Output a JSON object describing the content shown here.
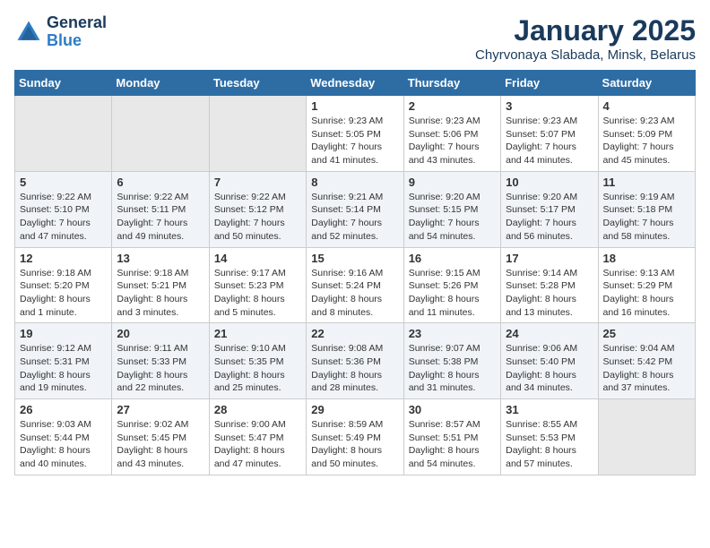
{
  "header": {
    "logo_line1": "General",
    "logo_line2": "Blue",
    "month_title": "January 2025",
    "location": "Chyrvonaya Slabada, Minsk, Belarus"
  },
  "weekdays": [
    "Sunday",
    "Monday",
    "Tuesday",
    "Wednesday",
    "Thursday",
    "Friday",
    "Saturday"
  ],
  "weeks": [
    [
      {
        "day": "",
        "empty": true
      },
      {
        "day": "",
        "empty": true
      },
      {
        "day": "",
        "empty": true
      },
      {
        "day": "1",
        "lines": [
          "Sunrise: 9:23 AM",
          "Sunset: 5:05 PM",
          "Daylight: 7 hours",
          "and 41 minutes."
        ]
      },
      {
        "day": "2",
        "lines": [
          "Sunrise: 9:23 AM",
          "Sunset: 5:06 PM",
          "Daylight: 7 hours",
          "and 43 minutes."
        ]
      },
      {
        "day": "3",
        "lines": [
          "Sunrise: 9:23 AM",
          "Sunset: 5:07 PM",
          "Daylight: 7 hours",
          "and 44 minutes."
        ]
      },
      {
        "day": "4",
        "lines": [
          "Sunrise: 9:23 AM",
          "Sunset: 5:09 PM",
          "Daylight: 7 hours",
          "and 45 minutes."
        ]
      }
    ],
    [
      {
        "day": "5",
        "lines": [
          "Sunrise: 9:22 AM",
          "Sunset: 5:10 PM",
          "Daylight: 7 hours",
          "and 47 minutes."
        ]
      },
      {
        "day": "6",
        "lines": [
          "Sunrise: 9:22 AM",
          "Sunset: 5:11 PM",
          "Daylight: 7 hours",
          "and 49 minutes."
        ]
      },
      {
        "day": "7",
        "lines": [
          "Sunrise: 9:22 AM",
          "Sunset: 5:12 PM",
          "Daylight: 7 hours",
          "and 50 minutes."
        ]
      },
      {
        "day": "8",
        "lines": [
          "Sunrise: 9:21 AM",
          "Sunset: 5:14 PM",
          "Daylight: 7 hours",
          "and 52 minutes."
        ]
      },
      {
        "day": "9",
        "lines": [
          "Sunrise: 9:20 AM",
          "Sunset: 5:15 PM",
          "Daylight: 7 hours",
          "and 54 minutes."
        ]
      },
      {
        "day": "10",
        "lines": [
          "Sunrise: 9:20 AM",
          "Sunset: 5:17 PM",
          "Daylight: 7 hours",
          "and 56 minutes."
        ]
      },
      {
        "day": "11",
        "lines": [
          "Sunrise: 9:19 AM",
          "Sunset: 5:18 PM",
          "Daylight: 7 hours",
          "and 58 minutes."
        ]
      }
    ],
    [
      {
        "day": "12",
        "lines": [
          "Sunrise: 9:18 AM",
          "Sunset: 5:20 PM",
          "Daylight: 8 hours",
          "and 1 minute."
        ]
      },
      {
        "day": "13",
        "lines": [
          "Sunrise: 9:18 AM",
          "Sunset: 5:21 PM",
          "Daylight: 8 hours",
          "and 3 minutes."
        ]
      },
      {
        "day": "14",
        "lines": [
          "Sunrise: 9:17 AM",
          "Sunset: 5:23 PM",
          "Daylight: 8 hours",
          "and 5 minutes."
        ]
      },
      {
        "day": "15",
        "lines": [
          "Sunrise: 9:16 AM",
          "Sunset: 5:24 PM",
          "Daylight: 8 hours",
          "and 8 minutes."
        ]
      },
      {
        "day": "16",
        "lines": [
          "Sunrise: 9:15 AM",
          "Sunset: 5:26 PM",
          "Daylight: 8 hours",
          "and 11 minutes."
        ]
      },
      {
        "day": "17",
        "lines": [
          "Sunrise: 9:14 AM",
          "Sunset: 5:28 PM",
          "Daylight: 8 hours",
          "and 13 minutes."
        ]
      },
      {
        "day": "18",
        "lines": [
          "Sunrise: 9:13 AM",
          "Sunset: 5:29 PM",
          "Daylight: 8 hours",
          "and 16 minutes."
        ]
      }
    ],
    [
      {
        "day": "19",
        "lines": [
          "Sunrise: 9:12 AM",
          "Sunset: 5:31 PM",
          "Daylight: 8 hours",
          "and 19 minutes."
        ]
      },
      {
        "day": "20",
        "lines": [
          "Sunrise: 9:11 AM",
          "Sunset: 5:33 PM",
          "Daylight: 8 hours",
          "and 22 minutes."
        ]
      },
      {
        "day": "21",
        "lines": [
          "Sunrise: 9:10 AM",
          "Sunset: 5:35 PM",
          "Daylight: 8 hours",
          "and 25 minutes."
        ]
      },
      {
        "day": "22",
        "lines": [
          "Sunrise: 9:08 AM",
          "Sunset: 5:36 PM",
          "Daylight: 8 hours",
          "and 28 minutes."
        ]
      },
      {
        "day": "23",
        "lines": [
          "Sunrise: 9:07 AM",
          "Sunset: 5:38 PM",
          "Daylight: 8 hours",
          "and 31 minutes."
        ]
      },
      {
        "day": "24",
        "lines": [
          "Sunrise: 9:06 AM",
          "Sunset: 5:40 PM",
          "Daylight: 8 hours",
          "and 34 minutes."
        ]
      },
      {
        "day": "25",
        "lines": [
          "Sunrise: 9:04 AM",
          "Sunset: 5:42 PM",
          "Daylight: 8 hours",
          "and 37 minutes."
        ]
      }
    ],
    [
      {
        "day": "26",
        "lines": [
          "Sunrise: 9:03 AM",
          "Sunset: 5:44 PM",
          "Daylight: 8 hours",
          "and 40 minutes."
        ]
      },
      {
        "day": "27",
        "lines": [
          "Sunrise: 9:02 AM",
          "Sunset: 5:45 PM",
          "Daylight: 8 hours",
          "and 43 minutes."
        ]
      },
      {
        "day": "28",
        "lines": [
          "Sunrise: 9:00 AM",
          "Sunset: 5:47 PM",
          "Daylight: 8 hours",
          "and 47 minutes."
        ]
      },
      {
        "day": "29",
        "lines": [
          "Sunrise: 8:59 AM",
          "Sunset: 5:49 PM",
          "Daylight: 8 hours",
          "and 50 minutes."
        ]
      },
      {
        "day": "30",
        "lines": [
          "Sunrise: 8:57 AM",
          "Sunset: 5:51 PM",
          "Daylight: 8 hours",
          "and 54 minutes."
        ]
      },
      {
        "day": "31",
        "lines": [
          "Sunrise: 8:55 AM",
          "Sunset: 5:53 PM",
          "Daylight: 8 hours",
          "and 57 minutes."
        ]
      },
      {
        "day": "",
        "empty": true
      }
    ]
  ]
}
